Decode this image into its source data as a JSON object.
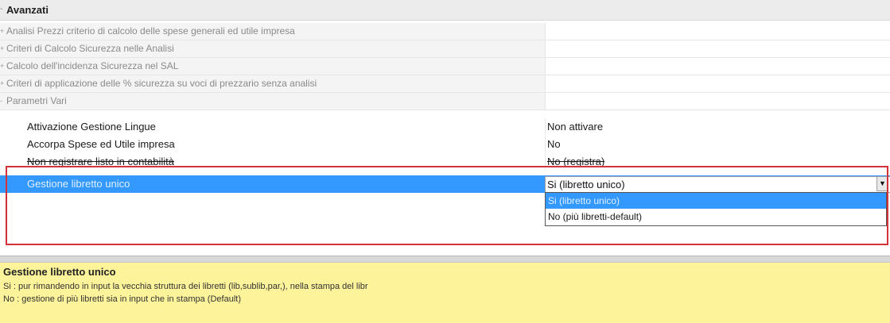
{
  "section": {
    "title": "Avanzati",
    "expand_glyph": "-"
  },
  "categories": [
    {
      "glyph": "+",
      "label": "Analisi Prezzi criterio di calcolo delle spese generali ed utile impresa",
      "value": ""
    },
    {
      "glyph": "+",
      "label": "Criteri di Calcolo Sicurezza nelle Analisi",
      "value": ""
    },
    {
      "glyph": "+",
      "label": "Calcolo dell'incidenza Sicurezza nel SAL",
      "value": ""
    },
    {
      "glyph": "+",
      "label": "Criteri di applicazione delle % sicurezza su voci di prezzario senza analisi",
      "value": ""
    },
    {
      "glyph": "-",
      "label": "Parametri Vari",
      "value": ""
    }
  ],
  "params": [
    {
      "label": "Attivazione Gestione Lingue",
      "value": "Non attivare"
    },
    {
      "label": "Accorpa Spese ed Utile impresa",
      "value": "No"
    },
    {
      "label": "Non registrare listo in contabilità",
      "value": "No (registra)"
    }
  ],
  "selected_param": {
    "label": "Gestione libretto unico",
    "value": "Si (libretto unico)",
    "button_glyph": "▼"
  },
  "dropdown_options": [
    "Si (libretto unico)",
    "No (più libretti-default)"
  ],
  "help": {
    "title": "Gestione libretto unico",
    "line1": "Si : pur rimandendo in input la vecchia struttura dei libretti (lib,sublib,par,), nella stampa del libr",
    "line2": "No : gestione di più libretti sia in input che in stampa (Default)"
  },
  "colors": {
    "selection": "#3399ff",
    "highlight_box": "#d2323a",
    "help_background": "#fcf39a"
  }
}
